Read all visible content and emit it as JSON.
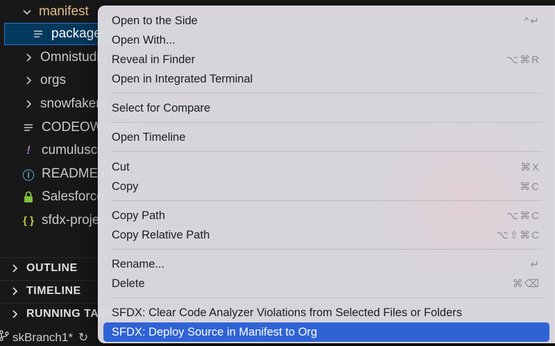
{
  "explorer": {
    "tree": [
      {
        "label": "manifest",
        "icon": "chevron-down",
        "type": "folder",
        "color": "#e2c08d"
      },
      {
        "label": "package",
        "icon": "lines",
        "type": "file",
        "selected": true,
        "color": "#ffffff"
      },
      {
        "label": "Omnistudio",
        "icon": "chevron-right",
        "type": "folder",
        "color": "#cccccc"
      },
      {
        "label": "orgs",
        "icon": "chevron-right",
        "type": "folder",
        "color": "#cccccc"
      },
      {
        "label": "snowfakery",
        "icon": "chevron-right",
        "type": "folder",
        "color": "#cccccc"
      },
      {
        "label": "CODEOWNERS",
        "icon": "lines",
        "type": "file",
        "color": "#cccccc"
      },
      {
        "label": "cumulusci",
        "icon": "!",
        "type": "file",
        "color": "#cccccc",
        "icon_color": "#a074c4"
      },
      {
        "label": "README.md",
        "icon": "ⓘ",
        "type": "file",
        "color": "#cccccc",
        "icon_color": "#519aba"
      },
      {
        "label": "Salesforce",
        "icon": "lock",
        "type": "file",
        "color": "#cccccc",
        "icon_color": "#7fbf3f"
      },
      {
        "label": "sfdx-project",
        "icon": "{ }",
        "type": "file",
        "color": "#cccccc",
        "icon_color": "#cbcb41"
      }
    ],
    "sections": [
      "OUTLINE",
      "TIMELINE",
      "RUNNING TASKS"
    ],
    "status": {
      "branch": "skBranch1*"
    }
  },
  "menu": {
    "groups": [
      [
        {
          "label": "Open to the Side",
          "shortcut": "^↵"
        },
        {
          "label": "Open With...",
          "shortcut": ""
        },
        {
          "label": "Reveal in Finder",
          "shortcut": "⌥⌘R"
        },
        {
          "label": "Open in Integrated Terminal",
          "shortcut": ""
        }
      ],
      [
        {
          "label": "Select for Compare",
          "shortcut": ""
        }
      ],
      [
        {
          "label": "Open Timeline",
          "shortcut": ""
        }
      ],
      [
        {
          "label": "Cut",
          "shortcut": "⌘X"
        },
        {
          "label": "Copy",
          "shortcut": "⌘C"
        }
      ],
      [
        {
          "label": "Copy Path",
          "shortcut": "⌥⌘C"
        },
        {
          "label": "Copy Relative Path",
          "shortcut": "⌥⇧⌘C"
        }
      ],
      [
        {
          "label": "Rename...",
          "shortcut": "↵"
        },
        {
          "label": "Delete",
          "shortcut": "⌘⌫"
        }
      ],
      [
        {
          "label": "SFDX: Clear Code Analyzer Violations from Selected Files or Folders",
          "shortcut": ""
        },
        {
          "label": "SFDX: Deploy Source in Manifest to Org",
          "shortcut": "",
          "active": true
        }
      ]
    ],
    "colors": {
      "highlight": "#2f63d5",
      "background": "#dedce2"
    }
  }
}
